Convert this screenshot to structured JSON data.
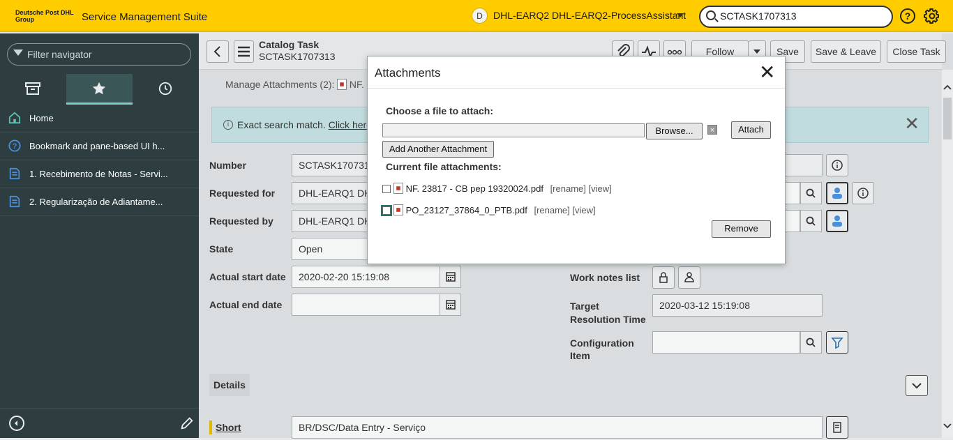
{
  "header": {
    "logo_text": "Deutsche Post DHL Group",
    "suite_title": "Service Management Suite",
    "user_initial": "D",
    "user_name": "DHL-EARQ2 DHL-EARQ2-ProcessAssistant",
    "search_value": "SCTASK1707313"
  },
  "navigator": {
    "filter_placeholder": "Filter navigator",
    "items": [
      {
        "label": "Home",
        "icon": "home-icon"
      },
      {
        "label": "Bookmark and pane-based UI h...",
        "icon": "help-circle-icon"
      },
      {
        "label": "1. Recebimento de Notas - Servi...",
        "icon": "list-document-icon"
      },
      {
        "label": "2. Regularização de Adiantame...",
        "icon": "list-document-icon"
      }
    ]
  },
  "form": {
    "title": "Catalog Task",
    "number": "SCTASK1707313",
    "buttons": {
      "follow": "Follow",
      "save": "Save",
      "save_leave": "Save & Leave",
      "close_task": "Close Task"
    },
    "manage_attachments": "Manage Attachments (2):",
    "manage_file_partial": "NF.",
    "banner": {
      "text": "Exact search match.",
      "link": "Click here",
      "tail": "t"
    },
    "fields": {
      "number_label": "Number",
      "number_value": "SCTASK1707313",
      "requested_for_label": "Requested for",
      "requested_for_value": "DHL-EARQ1 DH",
      "requested_by_label": "Requested by",
      "requested_by_value": "DHL-EARQ1 DH",
      "state_label": "State",
      "state_value": "Open",
      "actual_start_label": "Actual start date",
      "actual_start_value": "2020-02-20 15:19:08",
      "actual_end_label": "Actual end date",
      "actual_end_value": "",
      "work_notes_label": "Work notes list",
      "target_label_1": "Target",
      "target_label_2": "Resolution Time",
      "target_value": "2020-03-12 15:19:08",
      "config_label_1": "Configuration",
      "config_label_2": "Item",
      "config_value": ""
    },
    "details_label": "Details",
    "short_label": "Short",
    "short_value": "BR/DSC/Data Entry - Serviço"
  },
  "modal": {
    "title": "Attachments",
    "choose_label": "Choose a file to attach:",
    "browse": "Browse...",
    "attach": "Attach",
    "add_another": "Add Another Attachment",
    "current_label": "Current file attachments:",
    "files": [
      {
        "name": "NF. 23817 - CB pep 19320024.pdf",
        "links": "[rename] [view]"
      },
      {
        "name": "PO_23127_37864_0_PTB.pdf",
        "links": "[rename] [view]"
      }
    ],
    "remove": "Remove"
  }
}
